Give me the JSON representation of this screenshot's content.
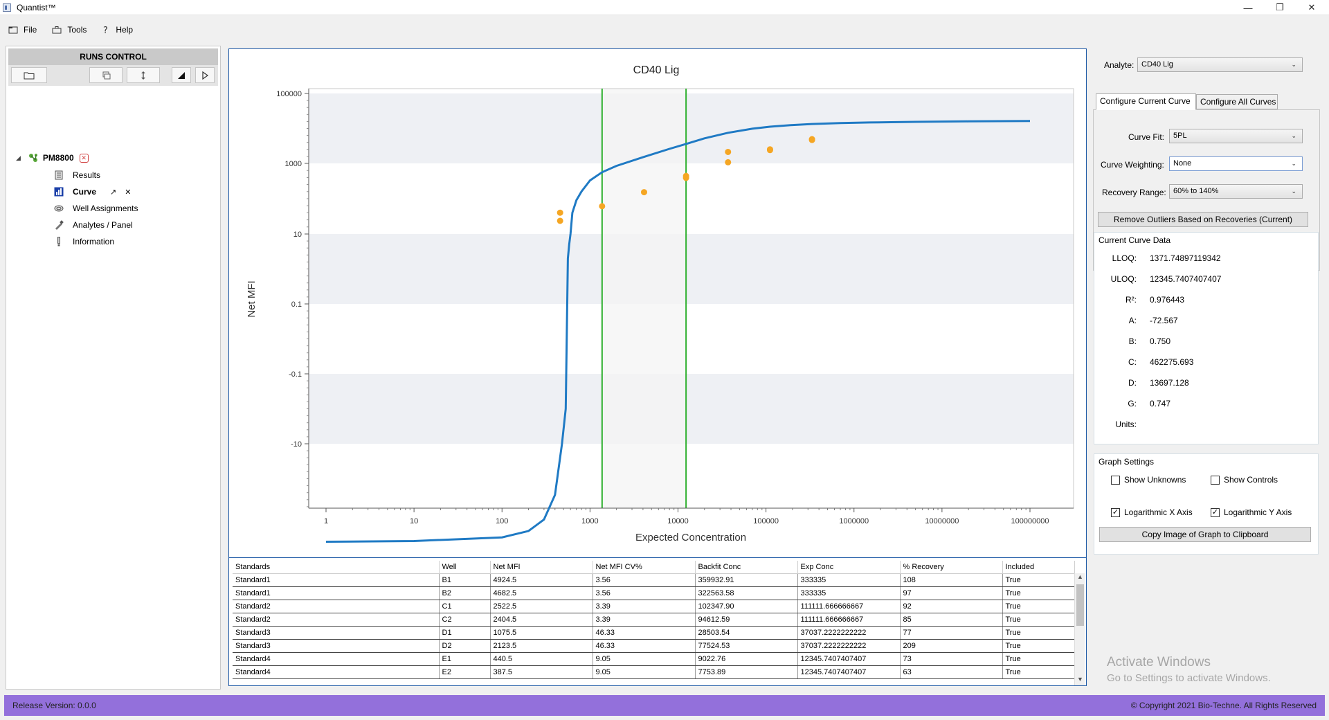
{
  "window": {
    "title": "Quantist™"
  },
  "menu": {
    "items": [
      "File",
      "Tools",
      "Help"
    ]
  },
  "runs_control": {
    "title": "RUNS CONTROL",
    "run": {
      "name": "PM8800"
    },
    "children": [
      "Results",
      "Curve",
      "Well Assignments",
      "Analytes / Panel",
      "Information"
    ]
  },
  "chart_data": {
    "type": "line",
    "title": "CD40 Lig",
    "xlabel": "Expected Concentration",
    "ylabel": "Net MFI",
    "x_scale": "log",
    "y_scale": "symlog",
    "x_ticks": [
      "1",
      "10",
      "100",
      "1000",
      "10000",
      "100000",
      "1000000",
      "10000000",
      "100000000"
    ],
    "y_ticks": [
      "100000",
      "1000",
      "10",
      "0.1",
      "-0.1",
      "-10"
    ],
    "vertical_lines": [
      1371.75,
      12345.74
    ],
    "curve": {
      "x": [
        1,
        10,
        100,
        200,
        300,
        400,
        480,
        530,
        560,
        580,
        600,
        630,
        700,
        800,
        1000,
        1371.75,
        2000,
        4000,
        8000,
        12345.74,
        20000,
        37037.22,
        70000,
        111111.67,
        200000,
        333335,
        700000,
        1500000,
        5000000,
        20000000,
        100000000
      ],
      "y": [
        -72,
        -71,
        -66,
        -58,
        -46,
        -28,
        -10,
        -1,
        2,
        5,
        10,
        40,
        90,
        160,
        330,
        560,
        850,
        1500,
        2600,
        3600,
        5200,
        7500,
        9800,
        11200,
        12500,
        13400,
        14200,
        14800,
        15400,
        15900,
        16300
      ]
    },
    "points": {
      "x": [
        333335,
        333335,
        111111.67,
        111111.67,
        37037.22,
        37037.22,
        12345.74,
        12345.74,
        4115.23,
        1371.75,
        457.25,
        457.25
      ],
      "y": [
        4924.5,
        4682.5,
        2522.5,
        2404.5,
        1075.5,
        2123.5,
        440.5,
        387.5,
        152.8,
        61.2,
        40.1,
        23.6
      ]
    },
    "colors": {
      "curve": "#1f7ac4",
      "points": "#f5a623",
      "lines": "#2fb02f",
      "band": "#eef0f4"
    }
  },
  "table": {
    "columns": [
      "Standards",
      "Well",
      "Net MFI",
      "Net MFI CV%",
      "Backfit Conc",
      "Exp Conc",
      "% Recovery",
      "Included"
    ],
    "rows": [
      [
        "Standard1",
        "B1",
        "4924.5",
        "3.56",
        "359932.91",
        "333335",
        "108",
        "True"
      ],
      [
        "Standard1",
        "B2",
        "4682.5",
        "3.56",
        "322563.58",
        "333335",
        "97",
        "True"
      ],
      [
        "Standard2",
        "C1",
        "2522.5",
        "3.39",
        "102347.90",
        "111111.666666667",
        "92",
        "True"
      ],
      [
        "Standard2",
        "C2",
        "2404.5",
        "3.39",
        "94612.59",
        "111111.666666667",
        "85",
        "True"
      ],
      [
        "Standard3",
        "D1",
        "1075.5",
        "46.33",
        "28503.54",
        "37037.2222222222",
        "77",
        "True"
      ],
      [
        "Standard3",
        "D2",
        "2123.5",
        "46.33",
        "77524.53",
        "37037.2222222222",
        "209",
        "True"
      ],
      [
        "Standard4",
        "E1",
        "440.5",
        "9.05",
        "9022.76",
        "12345.7407407407",
        "73",
        "True"
      ],
      [
        "Standard4",
        "E2",
        "387.5",
        "9.05",
        "7753.89",
        "12345.7407407407",
        "63",
        "True"
      ]
    ]
  },
  "right_panel": {
    "analyte_label": "Analyte:",
    "analyte_value": "CD40 Lig",
    "tabs": [
      "Configure Current Curve",
      "Configure All Curves"
    ],
    "curve_fit_label": "Curve Fit:",
    "curve_fit_value": "5PL",
    "curve_weighting_label": "Curve Weighting:",
    "curve_weighting_value": "None",
    "recovery_range_label": "Recovery Range:",
    "recovery_range_value": "60% to 140%",
    "remove_outliers_button": "Remove Outliers Based on Recoveries (Current)",
    "current_curve_data": {
      "title": "Current Curve Data",
      "labels": [
        "LLOQ:",
        "ULOQ:",
        "R²:",
        "A:",
        "B:",
        "C:",
        "D:",
        "G:",
        "Units:"
      ],
      "values": [
        "1371.74897119342",
        "12345.7407407407",
        "0.976443",
        "-72.567",
        "0.750",
        "462275.693",
        "13697.128",
        "0.747",
        ""
      ]
    },
    "graph_settings": {
      "title": "Graph Settings",
      "show_unknowns": "Show Unknowns",
      "show_controls": "Show Controls",
      "log_x": "Logarithmic X Axis",
      "log_y": "Logarithmic Y Axis",
      "copy_button": "Copy Image of Graph to Clipboard"
    }
  },
  "watermark": {
    "line1": "Activate Windows",
    "line2": "Go to Settings to activate Windows."
  },
  "footer": {
    "release": "Release Version: 0.0.0",
    "copyright": "© Copyright 2021 Bio-Techne. All Rights Reserved"
  }
}
